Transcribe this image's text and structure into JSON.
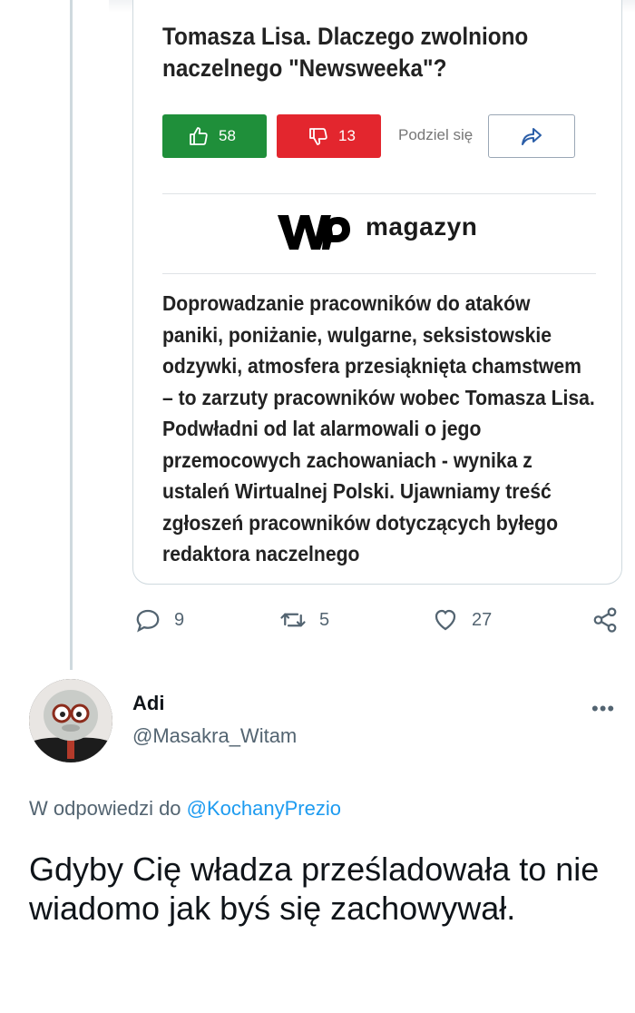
{
  "embedded_card": {
    "title": "Tomasza Lisa. Dlaczego zwolniono naczelnego \"Newsweeka\"?",
    "upvote_count": "58",
    "downvote_count": "13",
    "share_label": "Podziel się",
    "logo_text": "magazyn",
    "lead": "Doprowadzanie pracowników do ataków paniki, poniżanie, wulgarne, seksistowskie odzywki, atmosfera przesiąknięta chamstwem – to zarzuty pracowników wobec Tomasza Lisa. Podwładni od lat alarmowali o jego przemocowych zachowaniach - wynika z ustaleń Wirtualnej Polski. Ujawniamy treść zgłoszeń pracowników dotyczących byłego redaktora naczelnego",
    "colors": {
      "upvote": "#1f8f3a",
      "downvote": "#e3262e"
    }
  },
  "tweet_actions": {
    "replies": "9",
    "retweets": "5",
    "likes": "27"
  },
  "reply": {
    "name": "Adi",
    "handle": "@Masakra_Witam",
    "more_label": "•••",
    "in_reply_prefix": "W odpowiedzi do",
    "in_reply_mention": "@KochanyPrezio",
    "text": "Gdyby Cię władza prześladowała to nie wiadomo jak byś się zachowywał."
  },
  "colors": {
    "accent": "#1d9bf0",
    "muted": "#536471",
    "text": "#0f1419"
  }
}
